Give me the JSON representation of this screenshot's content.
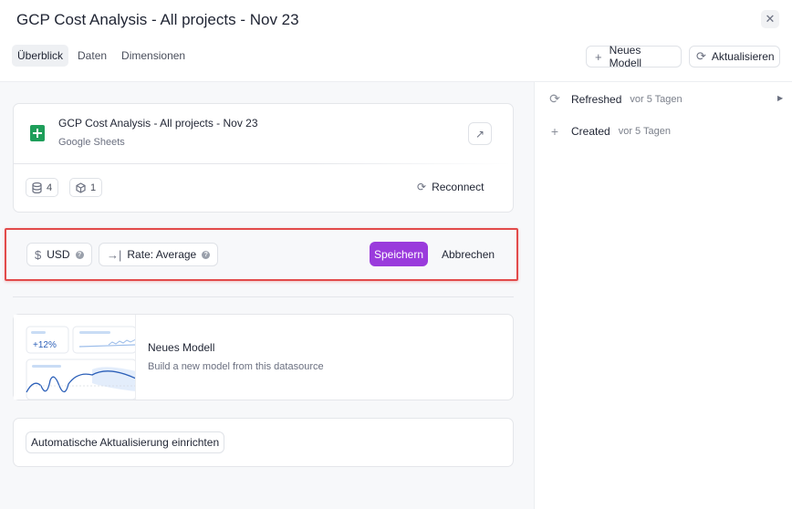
{
  "header": {
    "title": "GCP Cost Analysis - All projects - Nov 23",
    "close_icon": "close-icon"
  },
  "tabs": [
    {
      "label": "Überblick",
      "active": true
    },
    {
      "label": "Daten",
      "active": false
    },
    {
      "label": "Dimensionen",
      "active": false
    }
  ],
  "header_actions": {
    "new_model_label": "Neues Modell",
    "refresh_label": "Aktualisieren"
  },
  "source": {
    "title": "GCP Cost Analysis - All projects - Nov 23",
    "type": "Google Sheets",
    "tables_count": "4",
    "models_count": "1",
    "reconnect_label": "Reconnect"
  },
  "settings": {
    "currency": "USD",
    "rate": "Rate: Average",
    "save_label": "Speichern",
    "cancel_label": "Abbrechen",
    "accent_color": "#9a3bdc",
    "highlight_color": "#e24a4a"
  },
  "new_model": {
    "badge": "+12%",
    "title": "Neues Modell",
    "subtitle": "Build a new model from this datasource"
  },
  "auto_refresh_label": "Automatische Aktualisierung einrichten",
  "activity": [
    {
      "icon": "refresh-icon",
      "label": "Refreshed",
      "when": "vor 5 Tagen"
    },
    {
      "icon": "plus-icon",
      "label": "Created",
      "when": "vor 5 Tagen"
    }
  ]
}
